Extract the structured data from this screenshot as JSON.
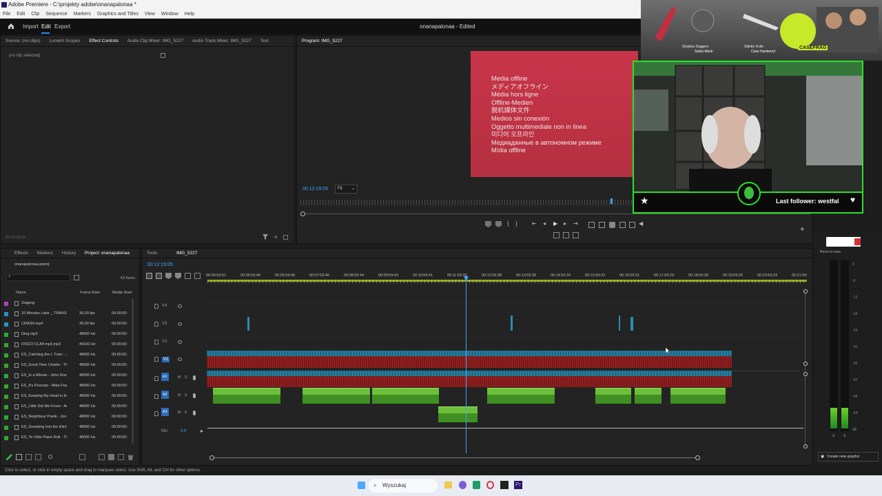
{
  "window": {
    "title": "Adobe Premiere - C:\\projekty adobe\\onanapalonaa *",
    "menu": [
      "File",
      "Edit",
      "Clip",
      "Sequence",
      "Markers",
      "Graphics and Titles",
      "View",
      "Window",
      "Help"
    ]
  },
  "header": {
    "workspaces": [
      "Import",
      "Edit",
      "Export"
    ],
    "active_workspace": "Edit",
    "project_title": "onanapalonaa - Edited"
  },
  "source_panel": {
    "tabs": [
      "Source: (no clips)",
      "Lumetri Scopes",
      "Effect Controls",
      "Audio Clip Mixer: IMG_5227",
      "Audio Track Mixer: IMG_5227",
      "Text"
    ],
    "active_tab": "Effect Controls",
    "no_clip": "(no clip selected)",
    "timecode": "00:12:19:05"
  },
  "program_panel": {
    "tab": "Program: IMG_5227",
    "timecode": "00:12:19:05",
    "fit": "Fit",
    "offline_lines": [
      "Media offline",
      "メディアオフライン",
      "Média hors ligne",
      "Offline-Medien",
      "脱机媒体文件",
      "Medios sin conexión",
      "Oggetto multimediale non in linea",
      "미디어 오프라인",
      "Медиаданные в автономном режиме",
      "Mídia offline"
    ]
  },
  "stream_overlay": {
    "follower_text": "Last follower: westfal",
    "brand": "CASEFRAG",
    "items": [
      "Shadow Daggers",
      "Safari Mesh",
      "Stiletto Knife",
      "Case Hardened"
    ]
  },
  "project_panel": {
    "tabs": [
      "Effects",
      "Markers",
      "History",
      "Project: onanapalonaa"
    ],
    "active_tab": "Project: onanapalonaa",
    "project_file": "onanapalonaa.prproj",
    "items_count": "63 Items",
    "columns": [
      "Name",
      "Frame Rate",
      "Media Start"
    ],
    "rows": [
      {
        "name": "2sigpng",
        "rate": "",
        "start": "",
        "color": "#b040c0"
      },
      {
        "name": "10 Minutes Later _ TRANSITI",
        "rate": "30,00 fps",
        "start": "00:00:00:",
        "color": "#2a8fd0"
      },
      {
        "name": "CRASH.mp4",
        "rate": "30,00 fps",
        "start": "00:00:00:",
        "color": "#2a8fd0"
      },
      {
        "name": "Ding.mp3",
        "rate": "48000 Hz",
        "start": "00:00:00:",
        "color": "#2fa82f"
      },
      {
        "name": "DISCO CLAP.mp3.mp3",
        "rate": "44100 Hz",
        "start": "00:00:00:",
        "color": "#2fa82f"
      },
      {
        "name": "ES_Catching the L Train - Joe",
        "rate": "48000 Hz",
        "start": "00:00:00:",
        "color": "#2fa82f"
      },
      {
        "name": "ES_Good Time Charlie - The",
        "rate": "48000 Hz",
        "start": "00:00:00:",
        "color": "#2fa82f"
      },
      {
        "name": "ES_In a Minute - John Runef",
        "rate": "48000 Hz",
        "start": "00:00:00:",
        "color": "#2fa82f"
      },
      {
        "name": "ES_It's Peanuts - Mika Frankl",
        "rate": "48000 Hz",
        "start": "00:00:00:",
        "color": "#2fa82f"
      },
      {
        "name": "ES_Keeping My Head in the",
        "rate": "48000 Hz",
        "start": "00:00:00:",
        "color": "#2fa82f"
      },
      {
        "name": "ES_Little Did We Know - Art",
        "rate": "48000 Hz",
        "start": "00:00:00:",
        "color": "#2fa82f"
      },
      {
        "name": "ES_Neighbour Prank - Jon Bj",
        "rate": "48000 Hz",
        "start": "00:00:00:",
        "color": "#2fa82f"
      },
      {
        "name": "ES_Sneaking Into the Kitche",
        "rate": "48000 Hz",
        "start": "00:00:00:",
        "color": "#2fa82f"
      },
      {
        "name": "ES_Ye Olde Piano Roll - The",
        "rate": "48000 Hz",
        "start": "00:00:00:",
        "color": "#2fa82f"
      }
    ]
  },
  "timeline": {
    "tabs": [
      "Tools",
      "IMG_5227"
    ],
    "timecode": "00:12:19:05",
    "ruler": [
      "00:04:59:51",
      "00:05:59:49",
      "00:06:59:48",
      "00:07:59:46",
      "00:08:59:44",
      "00:09:59:43",
      "00:10:59:41",
      "00:11:59:39",
      "00:12:59:38",
      "00:13:59:36",
      "00:14:59:34",
      "00:15:59:33",
      "00:16:59:31",
      "00:17:59:29",
      "00:18:59:28",
      "00:19:59:26",
      "00:20:59:24",
      "00:21:59:"
    ],
    "video_tracks": [
      "V4",
      "V3",
      "V2",
      "V1"
    ],
    "audio_tracks": [
      "A1",
      "A2",
      "A3"
    ],
    "mix_label": "Mix",
    "mix_value": "0,0"
  },
  "right_panel": {
    "link": "Reset to view",
    "button": "Create new graphic",
    "meter_scale": [
      "0",
      "-6",
      "-12",
      "-18",
      "-24",
      "-30",
      "-36",
      "-42",
      "-48",
      "-54",
      "dB"
    ],
    "meter_bottom": [
      "S",
      "S"
    ]
  },
  "status": {
    "hint": "Click to select, or click in empty space and drag to marquee select. Use Shift, Alt, and Ctrl for other options."
  },
  "taskbar": {
    "search": "Wyszukaj"
  },
  "colors": {
    "accent": "#2b8cff",
    "video_clip": "#1f6a86",
    "audio_offline": "#8b1c1c",
    "audio_green": "#4fa92f",
    "playhead": "#3ea6ff",
    "overlay_green": "#27e327"
  }
}
